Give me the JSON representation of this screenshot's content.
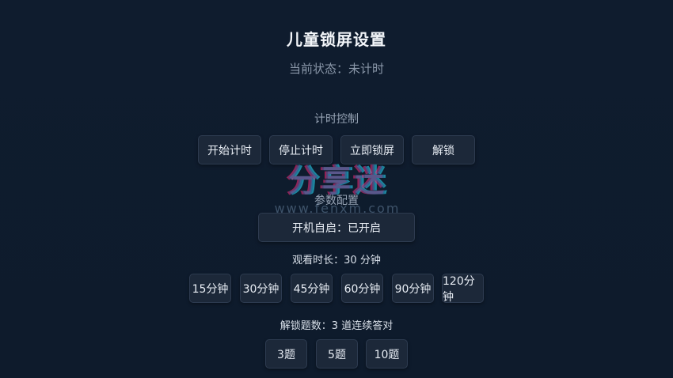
{
  "page": {
    "title": "儿童锁屏设置",
    "status": "当前状态：未计时"
  },
  "timer_control": {
    "label": "计时控制",
    "buttons": [
      "开始计时",
      "停止计时",
      "立即锁屏",
      "解锁"
    ]
  },
  "config": {
    "label": "参数配置",
    "autostart_button": "开机自启：已开启",
    "watch_duration_label": "观看时长：30 分钟",
    "duration_options": [
      "15分钟",
      "30分钟",
      "45分钟",
      "60分钟",
      "90分钟",
      "120分钟"
    ],
    "unlock_label": "解锁题数：3 道连续答对",
    "unlock_options": [
      "3题",
      "5题",
      "10题"
    ]
  },
  "watermark": {
    "logo_text": "分享迷",
    "url": "www.fenxm.com"
  },
  "colors": {
    "background": "#0f1c2e",
    "button": "#1c2839",
    "button_border": "#2d3b50"
  }
}
